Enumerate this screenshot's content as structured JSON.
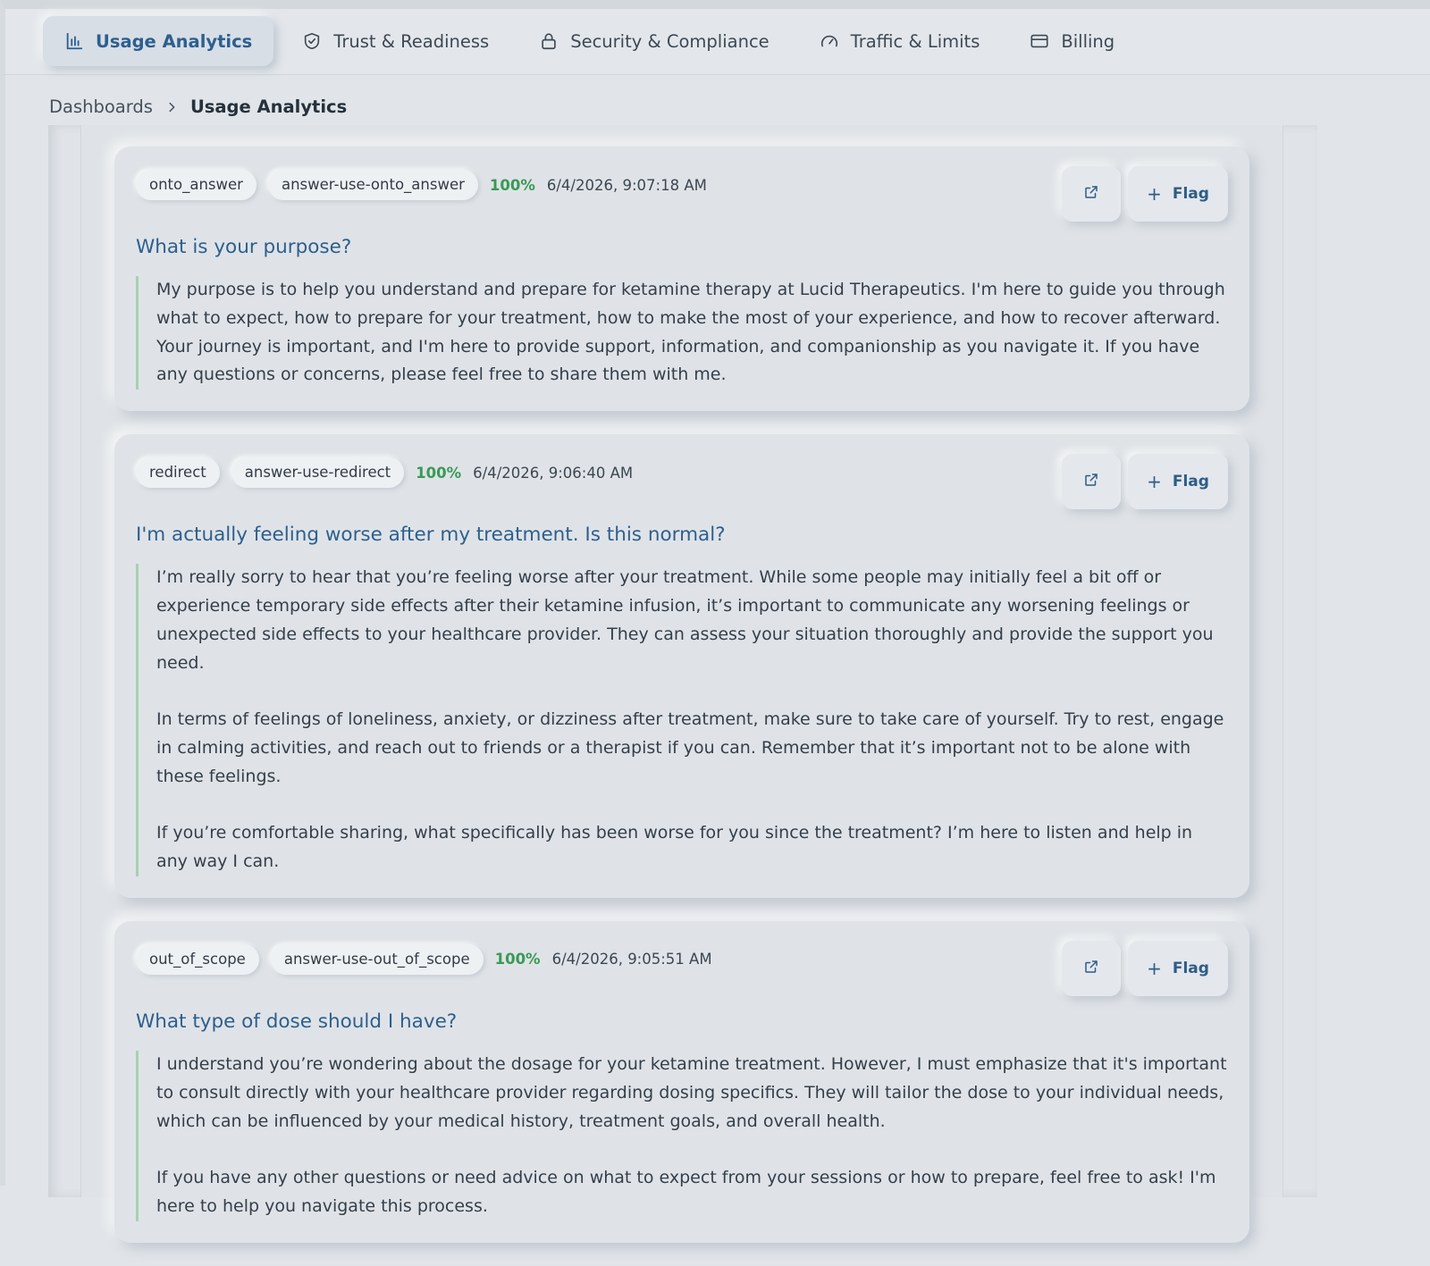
{
  "nav": {
    "tabs": [
      {
        "label": "Usage Analytics",
        "icon": "bar-chart-icon",
        "active": true
      },
      {
        "label": "Trust & Readiness",
        "icon": "shield-check-icon",
        "active": false
      },
      {
        "label": "Security & Compliance",
        "icon": "lock-icon",
        "active": false
      },
      {
        "label": "Traffic & Limits",
        "icon": "gauge-icon",
        "active": false
      },
      {
        "label": "Billing",
        "icon": "credit-card-icon",
        "active": false
      }
    ]
  },
  "breadcrumb": {
    "parent": "Dashboards",
    "current": "Usage Analytics"
  },
  "colors": {
    "accent": "#2d5f8f",
    "success": "#3a9a55",
    "background": "#e1e5e9"
  },
  "cards": [
    {
      "tag": "onto_answer",
      "use": "answer-use-onto_answer",
      "score": "100%",
      "timestamp": "6/4/2026, 9:07:18 AM",
      "question": "What is your purpose?",
      "answer": [
        "My purpose is to help you understand and prepare for ketamine therapy at Lucid Therapeutics. I'm here to guide you through what to expect, how to prepare for your treatment, how to make the most of your experience, and how to recover afterward. Your journey is important, and I'm here to provide support, information, and companionship as you navigate it. If you have any questions or concerns, please feel free to share them with me."
      ],
      "flag_label": "Flag"
    },
    {
      "tag": "redirect",
      "use": "answer-use-redirect",
      "score": "100%",
      "timestamp": "6/4/2026, 9:06:40 AM",
      "question": "I'm actually feeling worse after my treatment. Is this normal?",
      "answer": [
        "I’m really sorry to hear that you’re feeling worse after your treatment. While some people may initially feel a bit off or experience temporary side effects after their ketamine infusion, it’s important to communicate any worsening feelings or unexpected side effects to your healthcare provider. They can assess your situation thoroughly and provide the support you need.",
        "In terms of feelings of loneliness, anxiety, or dizziness after treatment, make sure to take care of yourself. Try to rest, engage in calming activities, and reach out to friends or a therapist if you can. Remember that it’s important not to be alone with these feelings.",
        "If you’re comfortable sharing, what specifically has been worse for you since the treatment? I’m here to listen and help in any way I can."
      ],
      "flag_label": "Flag"
    },
    {
      "tag": "out_of_scope",
      "use": "answer-use-out_of_scope",
      "score": "100%",
      "timestamp": "6/4/2026, 9:05:51 AM",
      "question": "What type of dose should I have?",
      "answer": [
        "I understand you’re wondering about the dosage for your ketamine treatment. However, I must emphasize that it's important to consult directly with your healthcare provider regarding dosing specifics. They will tailor the dose to your individual needs, which can be influenced by your medical history, treatment goals, and overall health.",
        "If you have any other questions or need advice on what to expect from your sessions or how to prepare, feel free to ask! I'm here to help you navigate this process."
      ],
      "flag_label": "Flag"
    }
  ]
}
